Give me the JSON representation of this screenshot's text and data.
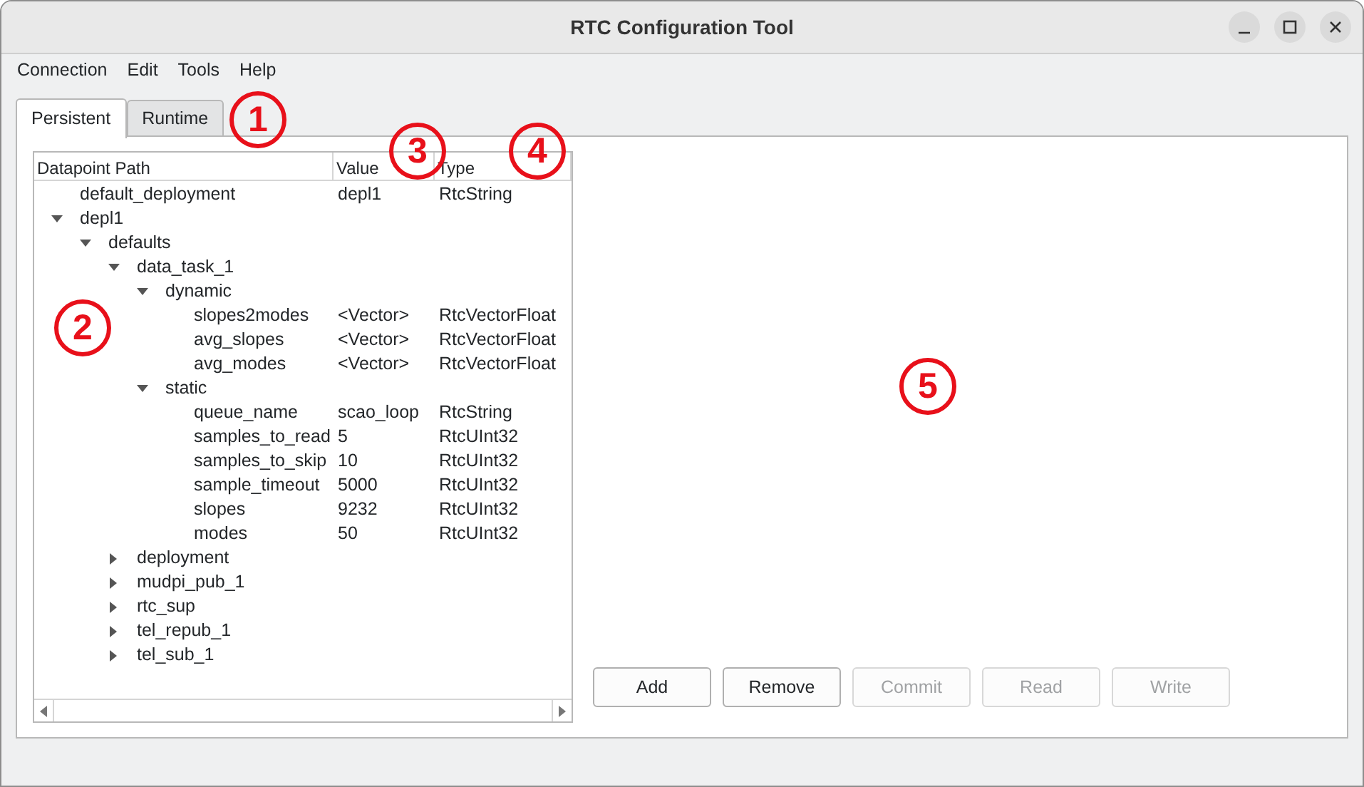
{
  "window": {
    "title": "RTC Configuration Tool"
  },
  "menu": [
    "Connection",
    "Edit",
    "Tools",
    "Help"
  ],
  "tabs": [
    {
      "label": "Persistent",
      "selected": true
    },
    {
      "label": "Runtime",
      "selected": false
    }
  ],
  "tree": {
    "columns": [
      "Datapoint Path",
      "Value",
      "Type"
    ],
    "items": [
      {
        "name": "default_deployment",
        "value": "depl1",
        "type": "RtcString"
      },
      {
        "name": "depl1",
        "expanded": true,
        "children": [
          {
            "name": "defaults",
            "expanded": true,
            "children": [
              {
                "name": "data_task_1",
                "expanded": true,
                "children": [
                  {
                    "name": "dynamic",
                    "expanded": true,
                    "children": [
                      {
                        "name": "slopes2modes",
                        "value": "<Vector>",
                        "type": "RtcVectorFloat"
                      },
                      {
                        "name": "avg_slopes",
                        "value": "<Vector>",
                        "type": "RtcVectorFloat"
                      },
                      {
                        "name": "avg_modes",
                        "value": "<Vector>",
                        "type": "RtcVectorFloat"
                      }
                    ]
                  },
                  {
                    "name": "static",
                    "expanded": true,
                    "children": [
                      {
                        "name": "queue_name",
                        "value": "scao_loop",
                        "type": "RtcString"
                      },
                      {
                        "name": "samples_to_read",
                        "value": "5",
                        "type": "RtcUInt32"
                      },
                      {
                        "name": "samples_to_skip",
                        "value": "10",
                        "type": "RtcUInt32"
                      },
                      {
                        "name": "sample_timeout",
                        "value": "5000",
                        "type": "RtcUInt32"
                      },
                      {
                        "name": "slopes",
                        "value": "9232",
                        "type": "RtcUInt32"
                      },
                      {
                        "name": "modes",
                        "value": "50",
                        "type": "RtcUInt32"
                      }
                    ]
                  }
                ]
              },
              {
                "name": "deployment",
                "expanded": false
              },
              {
                "name": "mudpi_pub_1",
                "expanded": false
              },
              {
                "name": "rtc_sup",
                "expanded": false
              },
              {
                "name": "tel_repub_1",
                "expanded": false
              },
              {
                "name": "tel_sub_1",
                "expanded": false
              }
            ]
          }
        ]
      }
    ]
  },
  "buttons": [
    {
      "label": "Add",
      "disabled": false
    },
    {
      "label": "Remove",
      "disabled": false
    },
    {
      "label": "Commit",
      "disabled": true
    },
    {
      "label": "Read",
      "disabled": true
    },
    {
      "label": "Write",
      "disabled": true
    }
  ],
  "annotations": [
    {
      "label": "1"
    },
    {
      "label": "2"
    },
    {
      "label": "3"
    },
    {
      "label": "4"
    },
    {
      "label": "5"
    }
  ]
}
